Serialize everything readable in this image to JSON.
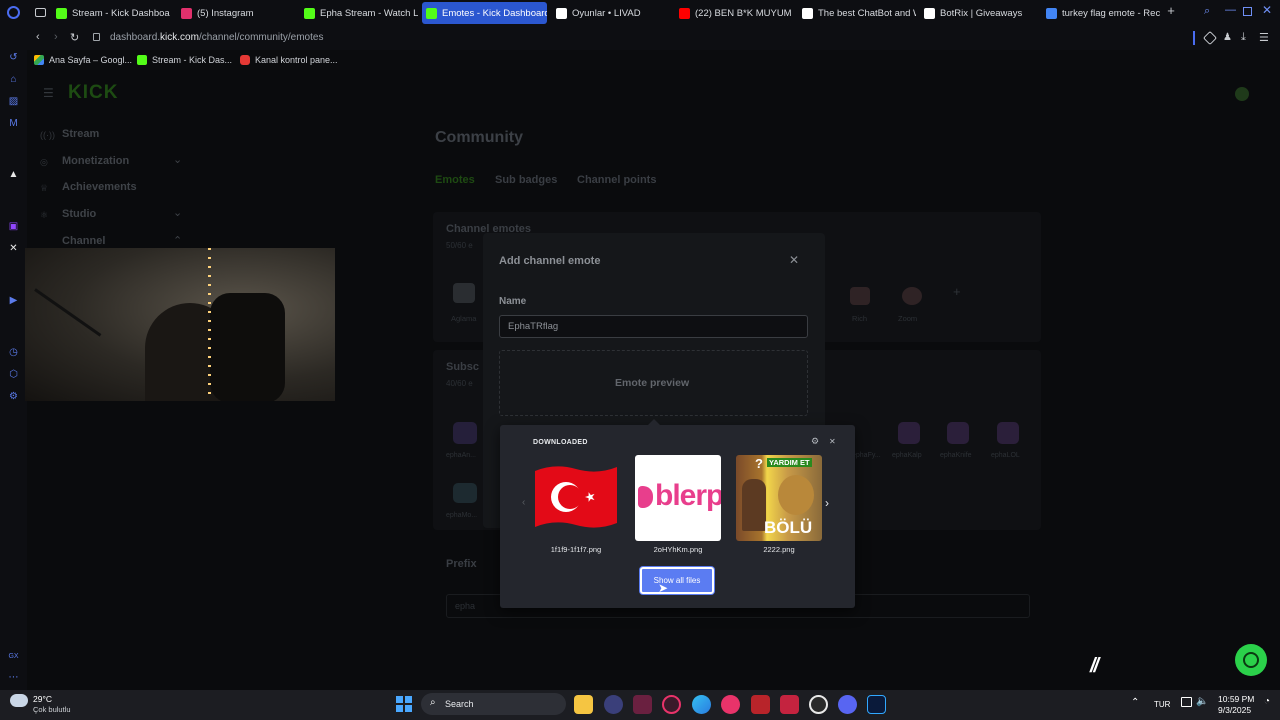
{
  "tabs": [
    {
      "label": "Stream - Kick Dashboard",
      "color": "#53fc18"
    },
    {
      "label": "(5) Instagram",
      "color": "#e1306c"
    },
    {
      "label": "Epha Stream - Watch Live",
      "color": "#53fc18"
    },
    {
      "label": "Emotes - Kick Dashboard",
      "color": "#53fc18",
      "active": true
    },
    {
      "label": "Oyunlar • LIVAD",
      "color": "#ffffff"
    },
    {
      "label": "(22) BEN B*K MUYUM |",
      "color": "#ff0000"
    },
    {
      "label": "The best ChatBot and W",
      "color": "#ffffff"
    },
    {
      "label": "BotRix | Giveaways",
      "color": "#ffffff"
    },
    {
      "label": "turkey flag emote - Rech",
      "color": "#4285f4"
    }
  ],
  "address": {
    "prefix": "dashboard.",
    "domain": "kick.com",
    "path": "/channel/community/emotes"
  },
  "bookmarks": [
    "Ana Sayfa – Googl...",
    "Stream - Kick Das...",
    "Kanal kontrol pane..."
  ],
  "sidebar_nav": {
    "logo": "KICK",
    "items": [
      "Stream",
      "Monetization",
      "Achievements",
      "Studio",
      "Channel"
    ]
  },
  "community": {
    "title": "Community",
    "tabs": [
      "Emotes",
      "Sub badges",
      "Channel points"
    ],
    "channel_emotes_title": "Channel emotes",
    "channel_emotes_count": "50/60 e",
    "emote_names": [
      "Aglama",
      "Rich",
      "Zoom"
    ],
    "subscriber_title": "Subsc",
    "subscriber_count": "40/60 e",
    "sub_emote_names": [
      "ephaAn...",
      "ephaFy...",
      "ephaKalp",
      "ephaKnife",
      "ephaLOL",
      "ephaMo..."
    ],
    "prefix_label": "Prefix",
    "prefix_value": "epha"
  },
  "modal": {
    "title": "Add channel emote",
    "name_label": "Name",
    "name_value": "EphaTRflag",
    "preview_label": "Emote preview"
  },
  "picker": {
    "title": "DOWNLOADED",
    "files": [
      "1f1f9-1f1f7.png",
      "2oHYhKm.png",
      "2222.png"
    ],
    "blerp_text": "blerp",
    "thumb3_top": "YARDIM ET",
    "thumb3_bottom": "BÖLÜ",
    "show_all": "Show all files"
  },
  "taskbar": {
    "weather_temp": "29°C",
    "weather_desc": "Çok bulutlu",
    "search": "Search",
    "lang": "TUR",
    "time": "10:59 PM",
    "date": "9/3/2025"
  }
}
